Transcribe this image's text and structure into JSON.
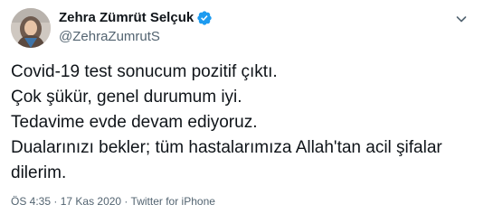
{
  "author": {
    "display_name": "Zehra Zümrüt Selçuk",
    "handle": "@ZehraZumrutS"
  },
  "tweet": {
    "lines": [
      "Covid-19 test sonucum pozitif çıktı.",
      "Çok şükür, genel durumum iyi.",
      "Tedavime evde devam ediyoruz.",
      "Dualarınızı bekler; tüm hastalarımıza Allah'tan acil şifalar",
      "dilerim."
    ]
  },
  "meta": {
    "time": "ÖS 4:35",
    "separator": " · ",
    "date": "17 Kas 2020",
    "source": "Twitter for iPhone"
  },
  "colors": {
    "text": "#0f1419",
    "secondary": "#536471",
    "verified": "#1d9bf0"
  },
  "icons": {
    "verified": "verified-badge-icon",
    "more": "more-chevron-icon"
  }
}
